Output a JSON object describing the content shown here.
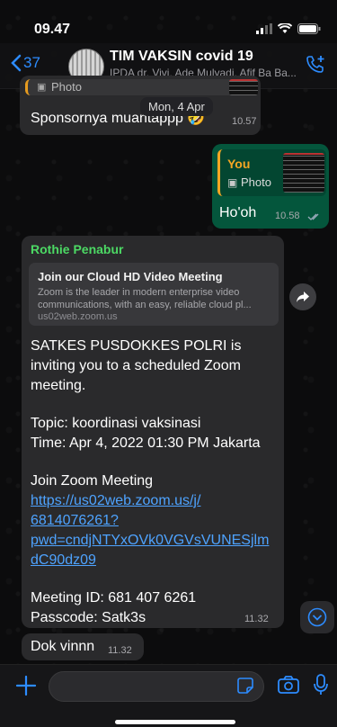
{
  "status": {
    "time": "09.47"
  },
  "header": {
    "back_count": "37",
    "title": "TIM VAKSIN covid 19",
    "subtitle": "IPDA dr. Vivi, Ade Mulyadi, Afif Ba Ba..."
  },
  "messages": {
    "m1": {
      "quote_label": "Photo",
      "text": "Sponsornya muantappp 🤣",
      "time": "10.57"
    },
    "date_separator": "Mon, 4 Apr",
    "m2": {
      "quote_author": "You",
      "quote_label": "Photo",
      "text": "Ho'oh",
      "time": "10.58"
    },
    "m3": {
      "sender": "Rothie Penabur",
      "preview_title": "Join our Cloud HD Video Meeting",
      "preview_desc": "Zoom is the leader in modern enterprise video\ncommunications, with an easy, reliable cloud pl...",
      "preview_domain": "us02web.zoom.us",
      "line1": "SATKES PUSDOKKES POLRI is",
      "line2": "inviting you to a scheduled Zoom",
      "line3": "meeting.",
      "line4": "Topic: koordinasi vaksinasi",
      "line5": "Time: Apr 4, 2022 01:30 PM Jakarta",
      "line6": "Join Zoom Meeting",
      "link1": "https://us02web.zoom.us/j/",
      "link2": "6814076261?",
      "link3": "pwd=cndjNTYxOVk0VGVsVUNESjlm",
      "link4": "dC90dz09",
      "line7": "Meeting ID: 681 407 6261",
      "line8": "Passcode: Satk3s",
      "time": "11.32"
    },
    "m4": {
      "text": "Dok vinnn",
      "time": "11.32"
    }
  },
  "colors": {
    "accent": "#2d8cff",
    "outgoing": "#04563c",
    "sender_green": "#4cd964",
    "quote_orange": "#f5a623"
  }
}
